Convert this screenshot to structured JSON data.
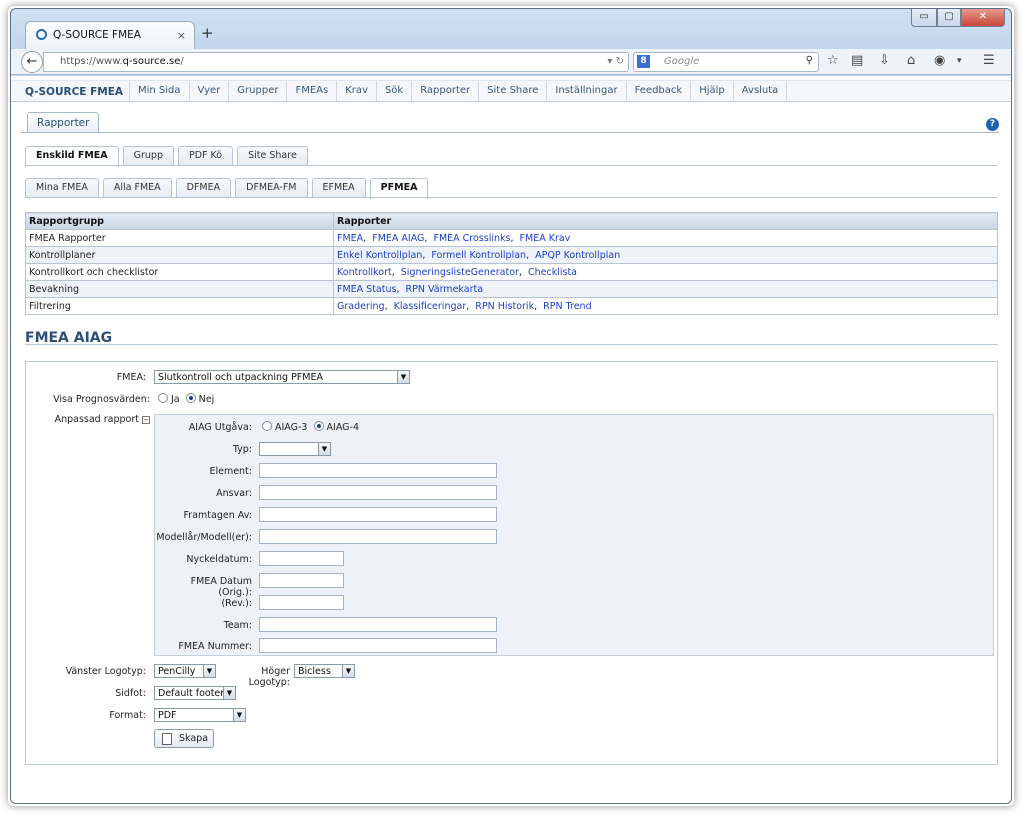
{
  "browser": {
    "tab_title": "Q-SOURCE FMEA",
    "tab_close": "×",
    "new_tab": "+",
    "url_prefix": "https://www.",
    "url_domain": "q-source.se",
    "url_suffix": "/",
    "search_placeholder": "Google",
    "window_controls": {
      "min": "▭",
      "max": "▢",
      "close": "✕"
    }
  },
  "app": {
    "brand": "Q-SOURCE FMEA",
    "menu": [
      "Min Sida",
      "Vyer",
      "Grupper",
      "FMEAs",
      "Krav",
      "Sök",
      "Rapporter",
      "Site Share",
      "Inställningar",
      "Feedback",
      "Hjälp",
      "Avsluta"
    ],
    "section_tab": "Rapporter",
    "help": "?"
  },
  "tabs_level1": [
    "Enskild FMEA",
    "Grupp",
    "PDF Kö",
    "Site Share"
  ],
  "tabs_level2": [
    "Mina FMEA",
    "Alla FMEA",
    "DFMEA",
    "DFMEA-FM",
    "EFMEA",
    "PFMEA"
  ],
  "reports": {
    "headers": [
      "Rapportgrupp",
      "Rapporter"
    ],
    "rows": [
      {
        "group": "FMEA Rapporter",
        "links": [
          "FMEA",
          "FMEA AIAG",
          "FMEA Crosslinks",
          "FMEA Krav"
        ]
      },
      {
        "group": "Kontrollplaner",
        "links": [
          "Enkel Kontrollplan",
          "Formell Kontrollplan",
          "APQP Kontrollplan"
        ]
      },
      {
        "group": "Kontrollkort och checklistor",
        "links": [
          "Kontrollkort",
          "SigneringslisteGenerator",
          "Checklista"
        ]
      },
      {
        "group": "Bevakning",
        "links": [
          "FMEA Status",
          "RPN Värmekarta"
        ]
      },
      {
        "group": "Filtrering",
        "links": [
          "Gradering",
          "Klassificeringar",
          "RPN Historik",
          "RPN Trend"
        ]
      }
    ]
  },
  "page_title": "FMEA AIAG",
  "form": {
    "fmea_label": "FMEA:",
    "fmea_value": "Slutkontroll och utpackning PFMEA",
    "prognos_label": "Visa Prognosvärden:",
    "prognos_ja": "Ja",
    "prognos_nej": "Nej",
    "custom_label": "Anpassad rapport",
    "custom_toggle": "−",
    "aiag_label": "AIAG Utgåva:",
    "aiag3": "AIAG-3",
    "aiag4": "AIAG-4",
    "typ_label": "Typ:",
    "element_label": "Element:",
    "ansvar_label": "Ansvar:",
    "framtagen_label": "Framtagen Av:",
    "modell_label": "Modellår/Modell(er):",
    "nyckel_label": "Nyckeldatum:",
    "datum_label": "FMEA Datum (Orig.):",
    "rev_label": "(Rev.):",
    "team_label": "Team:",
    "nummer_label": "FMEA Nummer:",
    "vlogo_label": "Vänster Logotyp:",
    "vlogo_value": "PenCilly",
    "hlogo_label": "Höger Logotyp:",
    "hlogo_value": "Bicless",
    "sidfot_label": "Sidfot:",
    "sidfot_value": "Default footer",
    "format_label": "Format:",
    "format_value": "PDF",
    "skapa": "Skapa"
  }
}
